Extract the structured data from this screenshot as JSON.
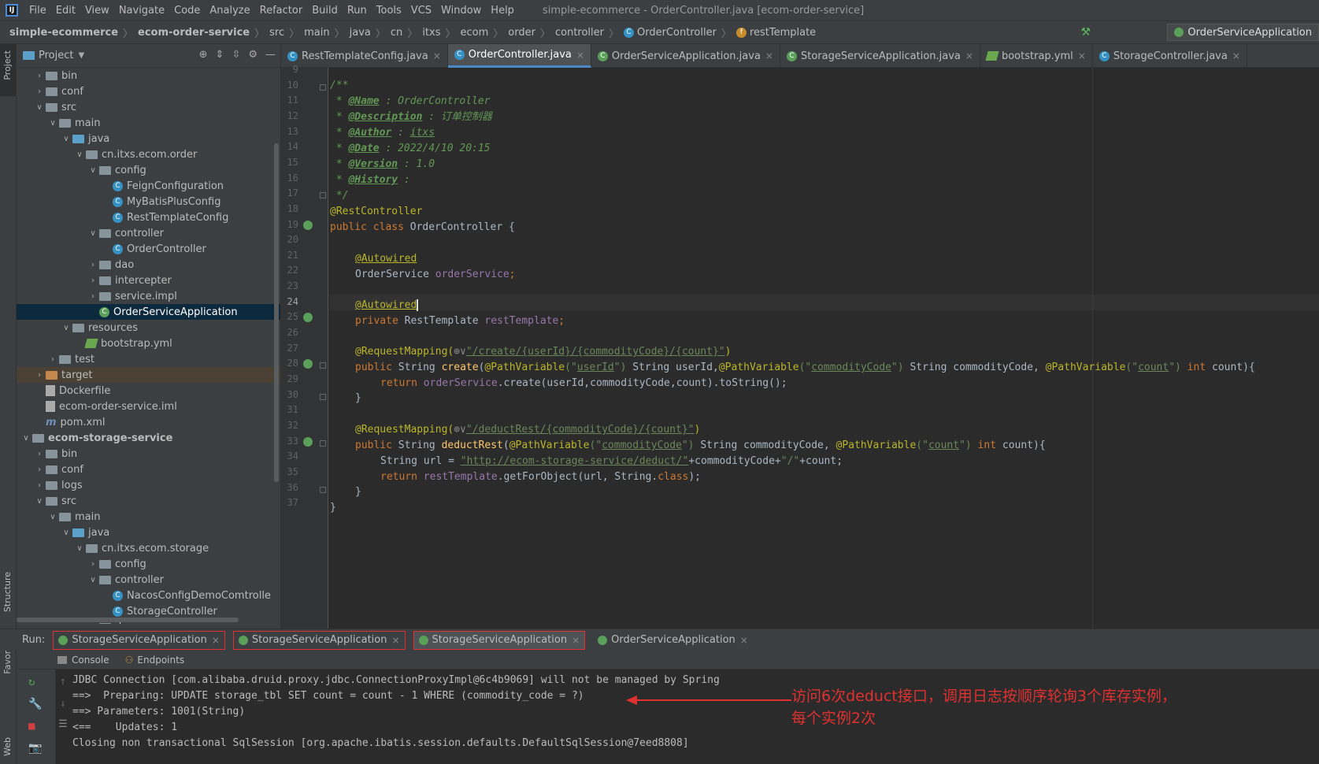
{
  "menubar": {
    "items": [
      "File",
      "Edit",
      "View",
      "Navigate",
      "Code",
      "Analyze",
      "Refactor",
      "Build",
      "Run",
      "Tools",
      "VCS",
      "Window",
      "Help"
    ],
    "window_title": "simple-ecommerce - OrderController.java [ecom-order-service]"
  },
  "breadcrumb": {
    "items": [
      "simple-ecommerce",
      "ecom-order-service",
      "src",
      "main",
      "java",
      "cn",
      "itxs",
      "ecom",
      "order",
      "controller",
      "OrderController",
      "restTemplate"
    ],
    "run_config": "OrderServiceApplication"
  },
  "sidebar": {
    "strip_labels": [
      "Project",
      "Structure",
      "Favorites",
      "Web"
    ]
  },
  "project": {
    "title": "Project",
    "tree": [
      {
        "label": "bin",
        "indent": 2,
        "type": "folder",
        "open": false
      },
      {
        "label": "conf",
        "indent": 2,
        "type": "folder",
        "open": false
      },
      {
        "label": "src",
        "indent": 2,
        "type": "folder",
        "open": true
      },
      {
        "label": "main",
        "indent": 3,
        "type": "folder",
        "open": true
      },
      {
        "label": "java",
        "indent": 4,
        "type": "folder-blue",
        "open": true
      },
      {
        "label": "cn.itxs.ecom.order",
        "indent": 5,
        "type": "pkg",
        "open": true
      },
      {
        "label": "config",
        "indent": 6,
        "type": "pkg",
        "open": true
      },
      {
        "label": "FeignConfiguration",
        "indent": 7,
        "type": "class"
      },
      {
        "label": "MyBatisPlusConfig",
        "indent": 7,
        "type": "class"
      },
      {
        "label": "RestTemplateConfig",
        "indent": 7,
        "type": "class"
      },
      {
        "label": "controller",
        "indent": 6,
        "type": "pkg",
        "open": true
      },
      {
        "label": "OrderController",
        "indent": 7,
        "type": "class"
      },
      {
        "label": "dao",
        "indent": 6,
        "type": "pkg",
        "open": false
      },
      {
        "label": "intercepter",
        "indent": 6,
        "type": "pkg",
        "open": false
      },
      {
        "label": "service.impl",
        "indent": 6,
        "type": "pkg",
        "open": false
      },
      {
        "label": "OrderServiceApplication",
        "indent": 6,
        "type": "class-spring",
        "selected": true
      },
      {
        "label": "resources",
        "indent": 4,
        "type": "folder",
        "open": true
      },
      {
        "label": "bootstrap.yml",
        "indent": 5,
        "type": "yml"
      },
      {
        "label": "test",
        "indent": 3,
        "type": "folder",
        "open": false
      },
      {
        "label": "target",
        "indent": 2,
        "type": "folder-orange",
        "open": false,
        "target": true
      },
      {
        "label": "Dockerfile",
        "indent": 2,
        "type": "file"
      },
      {
        "label": "ecom-order-service.iml",
        "indent": 2,
        "type": "file"
      },
      {
        "label": "pom.xml",
        "indent": 2,
        "type": "maven"
      },
      {
        "label": "ecom-storage-service",
        "indent": 1,
        "type": "module",
        "open": true,
        "bold": true
      },
      {
        "label": "bin",
        "indent": 2,
        "type": "folder",
        "open": false
      },
      {
        "label": "conf",
        "indent": 2,
        "type": "folder",
        "open": false
      },
      {
        "label": "logs",
        "indent": 2,
        "type": "folder",
        "open": false
      },
      {
        "label": "src",
        "indent": 2,
        "type": "folder",
        "open": true
      },
      {
        "label": "main",
        "indent": 3,
        "type": "folder",
        "open": true
      },
      {
        "label": "java",
        "indent": 4,
        "type": "folder-blue",
        "open": true
      },
      {
        "label": "cn.itxs.ecom.storage",
        "indent": 5,
        "type": "pkg",
        "open": true
      },
      {
        "label": "config",
        "indent": 6,
        "type": "pkg",
        "open": false
      },
      {
        "label": "controller",
        "indent": 6,
        "type": "pkg",
        "open": true
      },
      {
        "label": "NacosConfigDemoComtrolle",
        "indent": 7,
        "type": "class"
      },
      {
        "label": "StorageController",
        "indent": 7,
        "type": "class"
      },
      {
        "label": "dao",
        "indent": 6,
        "type": "pkg",
        "open": false
      }
    ]
  },
  "editor_tabs": [
    {
      "label": "RestTemplateConfig.java",
      "active": false
    },
    {
      "label": "OrderController.java",
      "active": true
    },
    {
      "label": "OrderServiceApplication.java",
      "active": false
    },
    {
      "label": "StorageServiceApplication.java",
      "active": false
    },
    {
      "label": "bootstrap.yml",
      "active": false
    },
    {
      "label": "StorageController.java",
      "active": false
    }
  ],
  "editor": {
    "line_numbers": [
      "9",
      "10",
      "11",
      "12",
      "13",
      "14",
      "15",
      "16",
      "17",
      "18",
      "19",
      "20",
      "21",
      "22",
      "23",
      "24",
      "25",
      "26",
      "27",
      "28",
      "29",
      "30",
      "31",
      "32",
      "33",
      "34",
      "35",
      "36",
      "37"
    ],
    "current_line": "24",
    "code": {
      "l10": "/**",
      "l11a": " * ",
      "l11t": "@Name",
      "l11b": " : OrderController",
      "l12a": " * ",
      "l12t": "@Description",
      "l12b": " : 订单控制器",
      "l13a": " * ",
      "l13t": "@Author",
      "l13b": " : ",
      "l13c": "itxs",
      "l14a": " * ",
      "l14t": "@Date",
      "l14b": " : 2022/4/10 20:15",
      "l15a": " * ",
      "l15t": "@Version",
      "l15b": " : 1.0",
      "l16a": " * ",
      "l16t": "@History",
      "l16b": " :",
      "l17": " */",
      "l18": "@RestController",
      "l19k": "public class ",
      "l19n": "OrderController {",
      "l21": "@Autowired",
      "l22a": "OrderService ",
      "l22f": "orderService",
      "l22s": ";",
      "l24": "@Autowired",
      "l25k": "private ",
      "l25t": "RestTemplate ",
      "l25f": "restTemplate",
      "l25s": ";",
      "l27a": "@RequestMapping(",
      "l27g": "⊕∨",
      "l27s": "\"/create/{userId}/{commodityCode}/{count}\"",
      "l27e": ")",
      "l28k": "public ",
      "l28t": "String ",
      "l28m": "create",
      "l28p1": "(",
      "l28a1": "@PathVariable",
      "l28s1": "(\"",
      "l28v1": "userId",
      "l28e1": "\")",
      "l28r1": " String userId,",
      "l28a2": "@PathVariable",
      "l28s2": "(\"",
      "l28v2": "commodityCode",
      "l28e2": "\")",
      "l28r2": " String commodityCode, ",
      "l28a3": "@PathVariable",
      "l28s3": "(\"",
      "l28v3": "count",
      "l28e3": "\")",
      "l28k2": " int ",
      "l28r3": "count){",
      "l29k": "return ",
      "l29f": "orderService",
      "l29r": ".create(userId,commodityCode,count).toString();",
      "l30": "}",
      "l32a": "@RequestMapping(",
      "l32g": "⊕∨",
      "l32s": "\"/deductRest/{commodityCode}/{count}\"",
      "l32e": ")",
      "l33k": "public ",
      "l33t": "String ",
      "l33m": "deductRest",
      "l33p": "(",
      "l33a1": "@PathVariable",
      "l33s1": "(\"",
      "l33v1": "commodityCode",
      "l33e1": "\")",
      "l33r1": " String commodityCode, ",
      "l33a2": "@PathVariable",
      "l33s2": "(\"",
      "l33v2": "count",
      "l33e2": "\")",
      "l33k2": " int ",
      "l33r2": "count){",
      "l34a": "String url = ",
      "l34s": "\"http://ecom-storage-service/deduct/\"",
      "l34b": "+commodityCode+",
      "l34s2": "\"/\"",
      "l34c": "+count;",
      "l35k": "return ",
      "l35f": "restTemplate",
      "l35r": ".getForObject(url, String.",
      "l35k2": "class",
      "l35e": ");",
      "l36": "}",
      "l37": "}"
    }
  },
  "run": {
    "label": "Run:",
    "tabs": [
      {
        "label": "StorageServiceApplication",
        "boxed": true
      },
      {
        "label": "StorageServiceApplication",
        "boxed": true
      },
      {
        "label": "StorageServiceApplication",
        "boxed": true,
        "active": true
      },
      {
        "label": "OrderServiceApplication",
        "boxed": false
      }
    ],
    "subtabs": [
      "Console",
      "Endpoints"
    ]
  },
  "console": {
    "lines": [
      "JDBC Connection [com.alibaba.druid.proxy.jdbc.ConnectionProxyImpl@6c4b9069] will not be managed by Spring",
      "==>  Preparing: UPDATE storage_tbl SET count = count - 1 WHERE (commodity_code = ?)",
      "==> Parameters: 1001(String)",
      "<==    Updates: 1",
      "Closing non transactional SqlSession [org.apache.ibatis.session.defaults.DefaultSqlSession@7eed8808]"
    ],
    "annotation_line1": "访问6次deduct接口，调用日志按顺序轮询3个库存实例，",
    "annotation_line2": "每个实例2次"
  },
  "colors": {
    "accent": "#4a88c7",
    "annotation": "#e03030",
    "selection": "#0d293e"
  }
}
